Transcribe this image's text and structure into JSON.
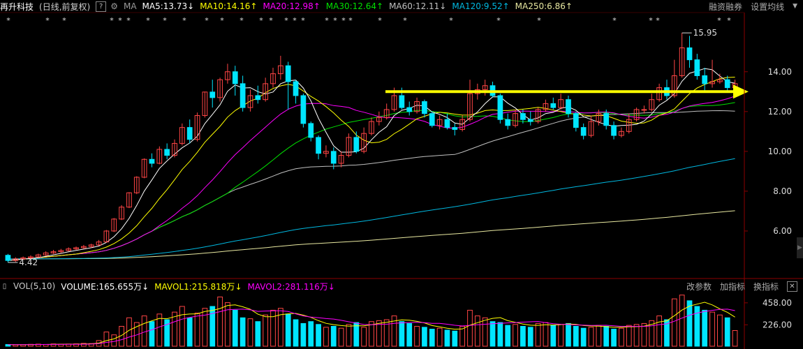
{
  "header": {
    "stock_name": "再升科技",
    "period": "(日线,前复权)",
    "help_icon": "?",
    "settings_icon": "gear-icon",
    "ma_label": "MA",
    "ma_items": [
      {
        "text": "MA5:13.73",
        "arrow": "↓",
        "color": "#ffffff"
      },
      {
        "text": "MA10:14.16",
        "arrow": "↑",
        "color": "#ffff00"
      },
      {
        "text": "MA20:12.98",
        "arrow": "↑",
        "color": "#ff00ff"
      },
      {
        "text": "MA30:12.64",
        "arrow": "↑",
        "color": "#00e000"
      },
      {
        "text": "MA60:12.11",
        "arrow": "↓",
        "color": "#c0c0c0"
      },
      {
        "text": "MA120:9.52",
        "arrow": "↑",
        "color": "#00b8e0"
      },
      {
        "text": "MA250:6.86",
        "arrow": "↑",
        "color": "#e8e8a0"
      }
    ],
    "links": [
      "融资融券",
      "设置均线"
    ],
    "collapse_icon": "▼"
  },
  "volume_header": {
    "vol_label": "VOL(5,10)",
    "volume": "VOLUME:165.655万",
    "volume_arrow": "↓",
    "mavol1": "MAVOL1:215.818万",
    "mavol1_arrow": "↓",
    "mavol2": "MAVOL2:281.116万",
    "mavol2_arrow": "↓",
    "links": [
      "改参数",
      "加指标",
      "换指标"
    ],
    "close_icon": "✕"
  },
  "annotations": {
    "high_label": "15.95",
    "low_label": "4.42"
  },
  "colors": {
    "up": "#ff4545",
    "down": "#00e5ff",
    "ma5": "#ffffff",
    "ma10": "#ffff00",
    "ma20": "#ff00ff",
    "ma30": "#00e000",
    "ma60": "#c0c0c0",
    "ma120": "#00b8e0",
    "ma250": "#e8e8a0",
    "trend_arrow": "#ffff00"
  },
  "chart_data": {
    "type": "candlestick",
    "price_ylim": [
      4,
      16.2
    ],
    "price_ticks": [
      "14.00",
      "12.00",
      "10.00",
      "8.00",
      "6.00"
    ],
    "volume_ylim": [
      0,
      560
    ],
    "volume_ticks": [
      "458.00",
      "226.00"
    ],
    "grid": false,
    "candles": [
      [
        4.78,
        4.52,
        4.85,
        4.42
      ],
      [
        4.52,
        4.6,
        4.68,
        4.45
      ],
      [
        4.6,
        4.65,
        4.72,
        4.55
      ],
      [
        4.65,
        4.7,
        4.78,
        4.6
      ],
      [
        4.7,
        4.8,
        4.86,
        4.66
      ],
      [
        4.8,
        4.9,
        4.98,
        4.75
      ],
      [
        4.9,
        4.96,
        5.05,
        4.85
      ],
      [
        4.96,
        5.02,
        5.1,
        4.9
      ],
      [
        5.02,
        5.1,
        5.18,
        4.98
      ],
      [
        5.1,
        5.16,
        5.22,
        5.04
      ],
      [
        5.16,
        5.22,
        5.3,
        5.1
      ],
      [
        5.22,
        5.3,
        5.36,
        5.16
      ],
      [
        5.3,
        5.45,
        5.55,
        5.26
      ],
      [
        5.45,
        6.0,
        6.05,
        5.42
      ],
      [
        6.0,
        6.6,
        6.65,
        5.95
      ],
      [
        6.6,
        7.2,
        7.3,
        6.55
      ],
      [
        7.2,
        7.92,
        7.95,
        7.15
      ],
      [
        7.92,
        8.7,
        8.75,
        7.85
      ],
      [
        8.7,
        9.6,
        9.65,
        8.65
      ],
      [
        9.6,
        9.4,
        9.9,
        9.2
      ],
      [
        9.4,
        10.1,
        10.25,
        9.35
      ],
      [
        10.1,
        9.8,
        10.4,
        9.6
      ],
      [
        9.8,
        10.4,
        10.6,
        9.7
      ],
      [
        10.4,
        11.2,
        11.4,
        10.3
      ],
      [
        11.2,
        10.6,
        11.6,
        10.4
      ],
      [
        10.6,
        11.8,
        11.95,
        10.5
      ],
      [
        11.8,
        12.98,
        13.0,
        11.7
      ],
      [
        12.98,
        12.7,
        13.6,
        12.2
      ],
      [
        12.7,
        13.6,
        13.7,
        12.5
      ],
      [
        13.6,
        14.0,
        14.4,
        13.4
      ],
      [
        14.0,
        13.4,
        14.3,
        12.8
      ],
      [
        13.4,
        12.2,
        13.8,
        12.0
      ],
      [
        12.2,
        12.8,
        13.1,
        12.0
      ],
      [
        12.8,
        12.6,
        13.3,
        12.4
      ],
      [
        12.6,
        13.4,
        13.7,
        12.5
      ],
      [
        13.4,
        13.9,
        14.2,
        13.2
      ],
      [
        13.9,
        14.3,
        14.8,
        13.6
      ],
      [
        14.3,
        13.5,
        14.5,
        12.1
      ],
      [
        13.5,
        12.8,
        13.6,
        12.4
      ],
      [
        12.8,
        11.4,
        12.9,
        11.2
      ],
      [
        11.4,
        10.7,
        11.5,
        10.5
      ],
      [
        10.7,
        9.9,
        10.8,
        9.6
      ],
      [
        9.9,
        10.0,
        10.3,
        9.7
      ],
      [
        10.0,
        9.4,
        10.2,
        9.1
      ],
      [
        9.4,
        9.8,
        10.0,
        9.2
      ],
      [
        9.8,
        10.7,
        10.9,
        9.7
      ],
      [
        10.7,
        10.0,
        11.0,
        9.9
      ],
      [
        10.0,
        10.9,
        11.2,
        9.9
      ],
      [
        10.9,
        11.5,
        11.7,
        10.8
      ],
      [
        11.5,
        11.7,
        12.0,
        11.3
      ],
      [
        11.7,
        12.1,
        12.4,
        11.6
      ],
      [
        12.1,
        12.8,
        13.2,
        12.0
      ],
      [
        12.8,
        12.2,
        13.2,
        12.1
      ],
      [
        12.2,
        12.0,
        12.5,
        11.8
      ],
      [
        12.0,
        12.5,
        12.7,
        11.9
      ],
      [
        12.5,
        11.9,
        12.6,
        11.7
      ],
      [
        11.9,
        11.3,
        12.0,
        11.2
      ],
      [
        11.3,
        11.6,
        11.8,
        11.1
      ],
      [
        11.6,
        11.2,
        11.9,
        11.1
      ],
      [
        11.2,
        11.1,
        11.4,
        10.8
      ],
      [
        11.1,
        11.6,
        11.8,
        11.0
      ],
      [
        11.6,
        12.9,
        13.6,
        11.5
      ],
      [
        12.9,
        13.1,
        13.4,
        12.6
      ],
      [
        13.1,
        13.3,
        13.6,
        12.8
      ],
      [
        13.3,
        12.8,
        13.5,
        12.7
      ],
      [
        12.8,
        11.6,
        12.9,
        11.4
      ],
      [
        11.6,
        11.3,
        11.9,
        11.1
      ],
      [
        11.3,
        11.9,
        12.1,
        11.2
      ],
      [
        11.9,
        11.6,
        12.1,
        11.4
      ],
      [
        11.6,
        11.5,
        12.0,
        11.3
      ],
      [
        11.5,
        12.1,
        12.2,
        11.4
      ],
      [
        12.1,
        12.4,
        12.6,
        12.0
      ],
      [
        12.4,
        12.2,
        12.7,
        12.1
      ],
      [
        12.2,
        12.6,
        12.9,
        12.1
      ],
      [
        12.6,
        11.9,
        12.8,
        11.7
      ],
      [
        11.9,
        11.2,
        12.0,
        11.0
      ],
      [
        11.2,
        10.8,
        11.4,
        10.6
      ],
      [
        10.8,
        11.5,
        11.8,
        10.7
      ],
      [
        11.5,
        11.9,
        12.1,
        11.3
      ],
      [
        11.9,
        11.3,
        12.1,
        11.1
      ],
      [
        11.3,
        10.8,
        11.5,
        10.6
      ],
      [
        10.8,
        11.0,
        11.2,
        10.7
      ],
      [
        11.0,
        11.6,
        11.9,
        10.9
      ],
      [
        11.6,
        12.1,
        12.2,
        11.5
      ],
      [
        12.1,
        12.1,
        12.3,
        11.9
      ],
      [
        12.1,
        12.6,
        12.9,
        12.0
      ],
      [
        12.6,
        13.2,
        13.4,
        12.5
      ],
      [
        13.2,
        12.8,
        13.6,
        12.6
      ],
      [
        12.8,
        13.8,
        14.6,
        12.7
      ],
      [
        13.8,
        15.2,
        15.95,
        13.7
      ],
      [
        15.2,
        14.6,
        15.8,
        14.2
      ],
      [
        14.6,
        13.8,
        14.9,
        13.6
      ],
      [
        13.8,
        13.4,
        14.2,
        13.0
      ],
      [
        13.4,
        13.5,
        14.6,
        13.2
      ],
      [
        13.5,
        13.6,
        13.9,
        13.4
      ],
      [
        13.6,
        13.2,
        13.8,
        13.0
      ],
      [
        13.2,
        13.4,
        13.6,
        13.1
      ]
    ],
    "volumes": [
      18,
      15,
      16,
      20,
      22,
      19,
      24,
      21,
      23,
      25,
      30,
      28,
      60,
      150,
      120,
      210,
      300,
      250,
      320,
      260,
      340,
      280,
      360,
      420,
      300,
      350,
      400,
      420,
      520,
      460,
      380,
      300,
      290,
      260,
      330,
      380,
      400,
      340,
      280,
      240,
      260,
      230,
      200,
      210,
      190,
      230,
      250,
      200,
      260,
      270,
      280,
      320,
      260,
      240,
      210,
      200,
      180,
      190,
      170,
      160,
      210,
      380,
      320,
      300,
      260,
      250,
      220,
      230,
      210,
      200,
      240,
      250,
      220,
      230,
      240,
      210,
      190,
      200,
      220,
      210,
      180,
      190,
      220,
      230,
      240,
      270,
      320,
      280,
      500,
      540,
      480,
      420,
      380,
      360,
      330,
      300,
      165.655
    ]
  }
}
